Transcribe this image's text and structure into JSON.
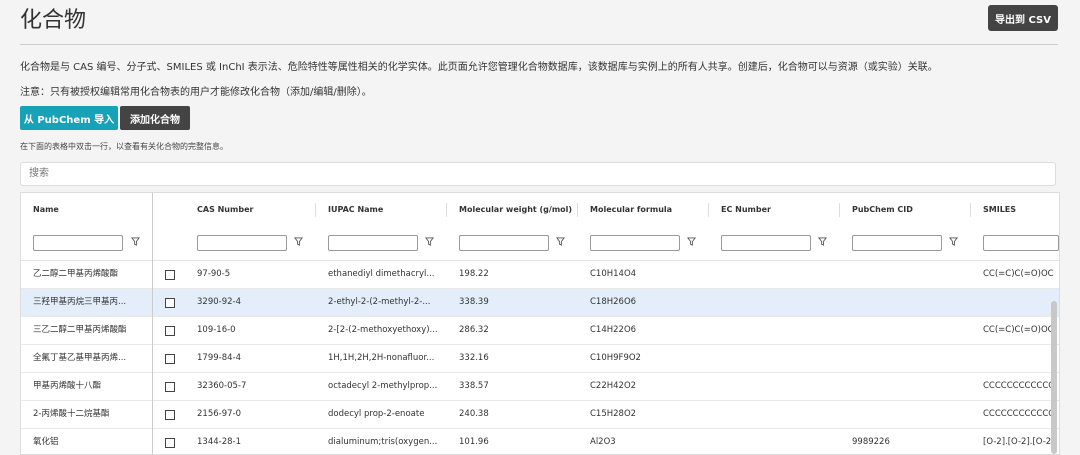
{
  "page": {
    "title": "化合物",
    "export_label": "导出到 CSV",
    "description": "化合物是与 CAS 编号、分子式、SMILES 或 InChI 表示法、危险特性等属性相关的化学实体。此页面允许您管理化合物数据库，该数据库与实例上的所有人共享。创建后，化合物可以与资源（或实验）关联。",
    "note": "注意：只有被授权编辑常用化合物表的用户才能修改化合物（添加/编辑/删除）。",
    "import_pubchem_label": "从 PubChem 导入",
    "add_compound_label": "添加化合物",
    "hint": "在下面的表格中双击一行，以查看有关化合物的完整信息。",
    "search_placeholder": "搜索"
  },
  "columns": [
    "Name",
    "CAS Number",
    "IUPAC Name",
    "Molecular weight (g/mol)",
    "Molecular formula",
    "EC Number",
    "PubChem CID",
    "SMILES"
  ],
  "rows": [
    {
      "name": "乙二醇二甲基丙烯酸酯",
      "cas": "97-90-5",
      "iupac": "ethanediyl dimethacryl...",
      "mw": "198.22",
      "formula": "C10H14O4",
      "ec": "",
      "cid": "",
      "smiles": "CC(=C)C(=O)OC"
    },
    {
      "name": "三羟甲基丙烷三甲基丙...",
      "cas": "3290-92-4",
      "iupac": "2-ethyl-2-(2-methyl-2-...",
      "mw": "338.39",
      "formula": "C18H26O6",
      "ec": "",
      "cid": "",
      "smiles": ""
    },
    {
      "name": "三乙二醇二甲基丙烯酸酯",
      "cas": "109-16-0",
      "iupac": "2-[2-(2-methoxyethoxy)...",
      "mw": "286.32",
      "formula": "C14H22O6",
      "ec": "",
      "cid": "",
      "smiles": "CC(=C)C(=O)OC"
    },
    {
      "name": "全氟丁基乙基甲基丙烯...",
      "cas": "1799-84-4",
      "iupac": "1H,1H,2H,2H-nonafluor...",
      "mw": "332.16",
      "formula": "C10H9F9O2",
      "ec": "",
      "cid": "",
      "smiles": ""
    },
    {
      "name": "甲基丙烯酸十八酯",
      "cas": "32360-05-7",
      "iupac": "octadecyl 2-methylprop...",
      "mw": "338.57",
      "formula": "C22H42O2",
      "ec": "",
      "cid": "",
      "smiles": "CCCCCCCCCCCC"
    },
    {
      "name": "2-丙烯酸十二烷基酯",
      "cas": "2156-97-0",
      "iupac": "dodecyl prop-2-enoate",
      "mw": "240.38",
      "formula": "C15H28O2",
      "ec": "",
      "cid": "",
      "smiles": "CCCCCCCCCCCC"
    },
    {
      "name": "氧化铝",
      "cas": "1344-28-1",
      "iupac": "dialuminum;tris(oxygen...",
      "mw": "101.96",
      "formula": "Al2O3",
      "ec": "",
      "cid": "9989226",
      "smiles": "[O-2].[O-2].[O-2"
    }
  ],
  "selected_row": 1,
  "colors": {
    "accent": "#17a2b8",
    "dark_button": "#444444",
    "selected_row_bg": "#e3eefa"
  }
}
